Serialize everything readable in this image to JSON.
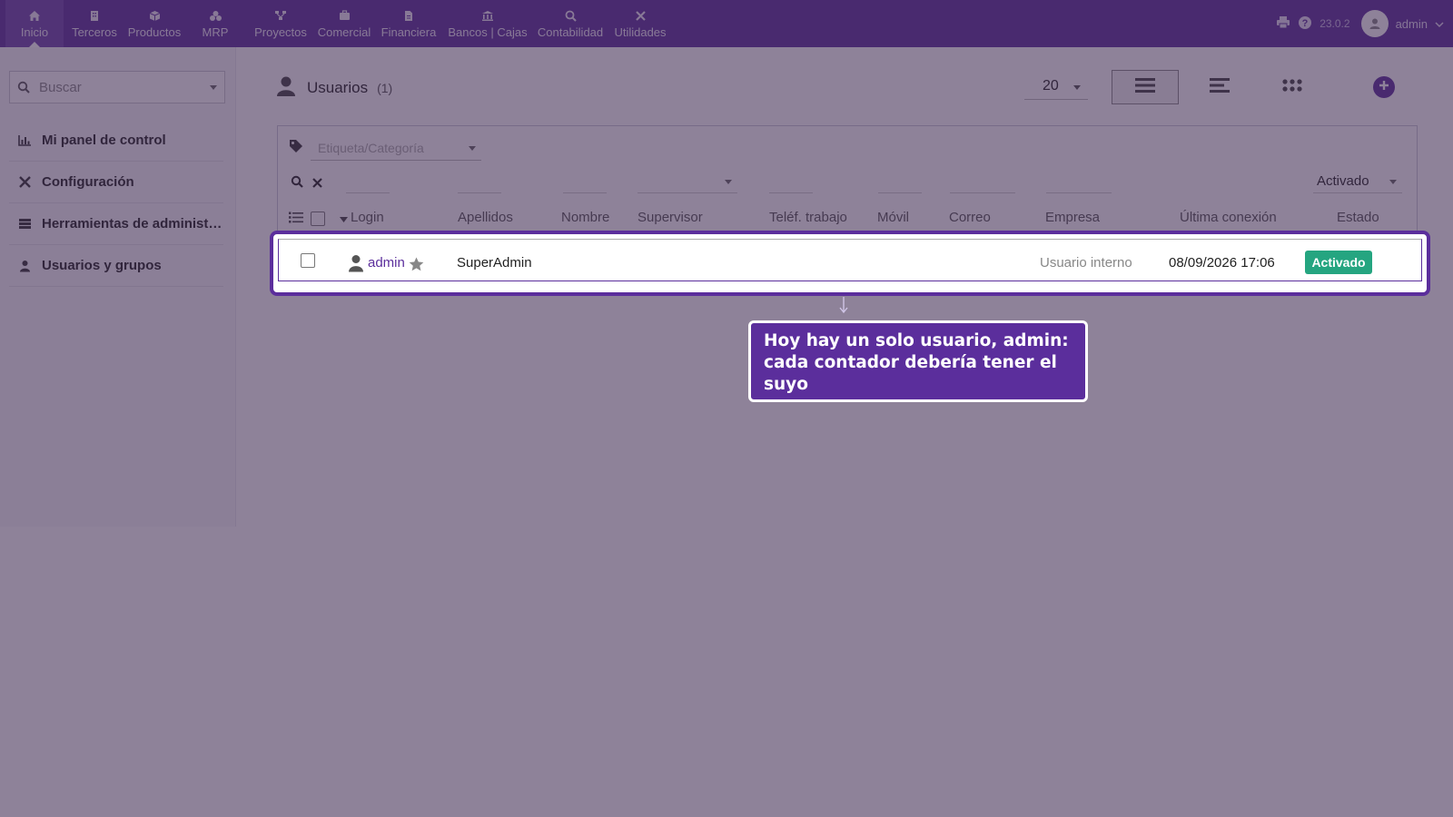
{
  "topbar": {
    "menu": [
      {
        "label": "Inicio",
        "icon": "home-icon"
      },
      {
        "label": "Terceros",
        "icon": "building-icon"
      },
      {
        "label": "Productos",
        "icon": "cube-icon"
      },
      {
        "label": "MRP",
        "icon": "cubes-icon"
      },
      {
        "label": "Proyectos",
        "icon": "sitemap-icon"
      },
      {
        "label": "Comercial",
        "icon": "suitcase-icon"
      },
      {
        "label": "Financiera",
        "icon": "file-invoice-icon"
      },
      {
        "label": "Bancos | Cajas",
        "icon": "bank-icon"
      },
      {
        "label": "Contabilidad",
        "icon": "search-dollar-icon"
      },
      {
        "label": "Utilidades",
        "icon": "tools-icon"
      }
    ],
    "version": "23.0.2",
    "user": "admin"
  },
  "sidebar": {
    "search_placeholder": "Buscar",
    "items": [
      {
        "label": "Mi panel de control",
        "icon": "chart-bar-icon"
      },
      {
        "label": "Configuración",
        "icon": "tools-icon"
      },
      {
        "label": "Herramientas de administración",
        "icon": "server-icon"
      },
      {
        "label": "Usuarios y grupos",
        "icon": "user-icon"
      }
    ]
  },
  "page": {
    "title": "Usuarios",
    "count": "(1)",
    "limit": "20"
  },
  "list": {
    "tag_placeholder": "Etiqueta/Categoría",
    "status_filter": "Activado",
    "columns": [
      "Login",
      "Apellidos",
      "Nombre",
      "Supervisor",
      "Teléf. trabajo",
      "Móvil",
      "Correo",
      "Empresa",
      "Última conexión",
      "Estado"
    ],
    "rows": [
      {
        "login": "admin",
        "lastname": "SuperAdmin",
        "company": "Usuario interno",
        "last_login": "08/09/2026 17:06",
        "status": "Activado"
      }
    ]
  },
  "tooltip": {
    "text": "Hoy hay un solo usuario, admin: cada contador debería tener el suyo"
  },
  "colors": {
    "brand": "#5b2e9c",
    "status_active": "#25a580"
  }
}
